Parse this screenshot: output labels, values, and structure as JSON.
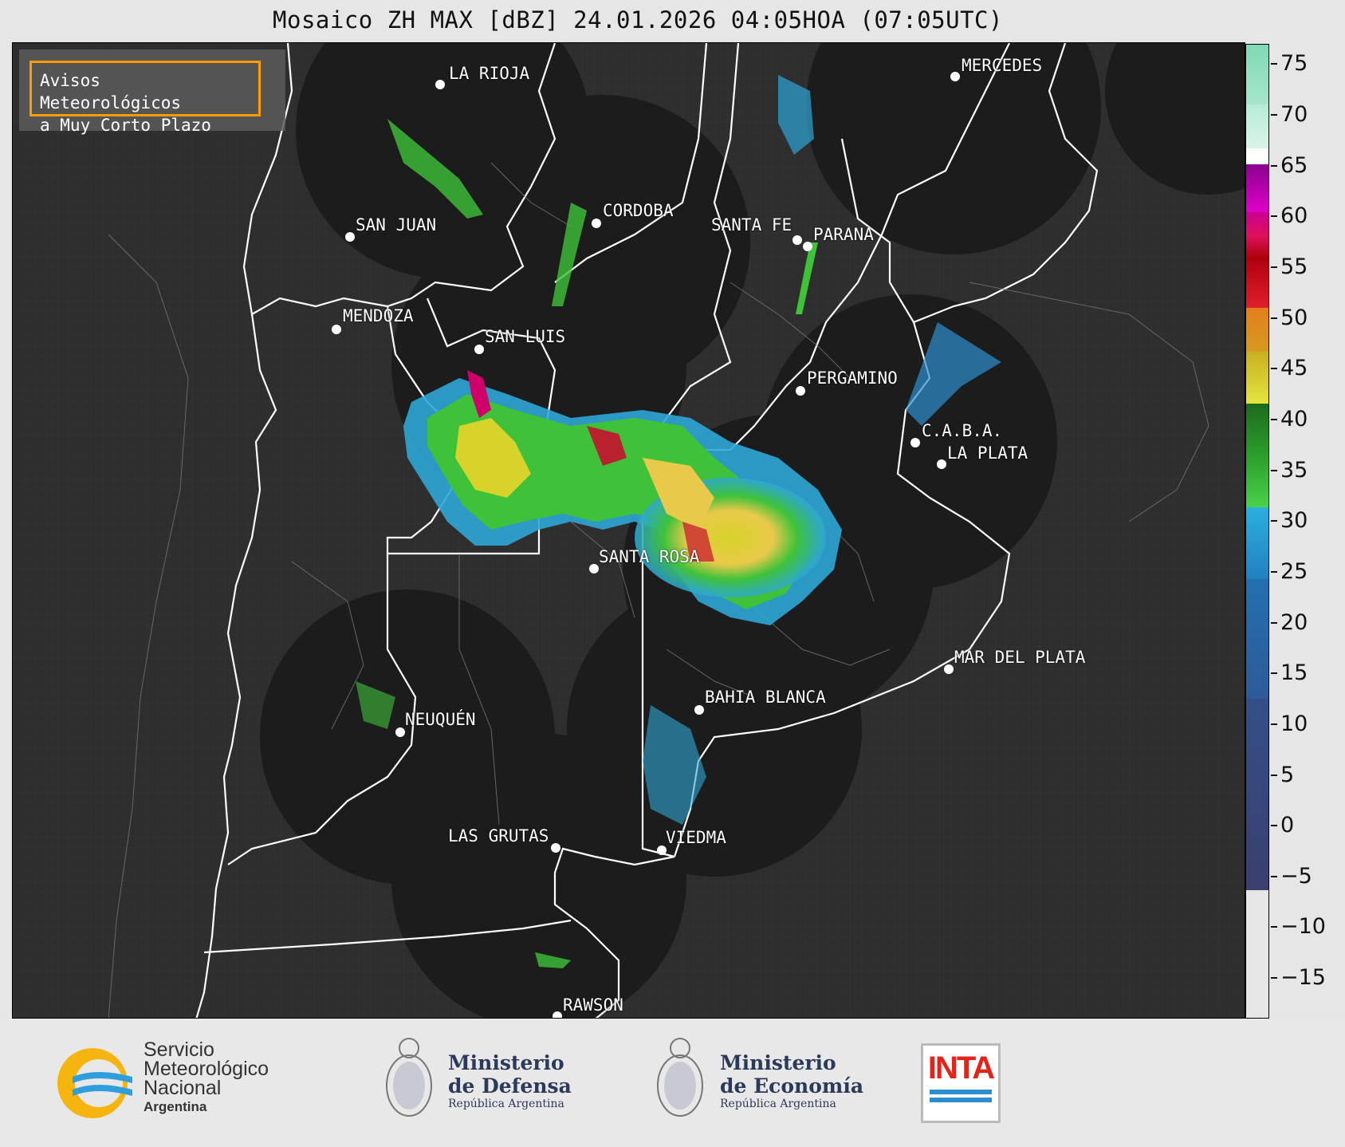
{
  "title": "Mosaico ZH MAX [dBZ] 24.01.2026 04:05HOA (07:05UTC)",
  "avisos": {
    "line1": "Avisos Meteorológicos",
    "line2": "a Muy Corto Plazo"
  },
  "cities": [
    {
      "name": "LA RIOJA"
    },
    {
      "name": "MERCEDES"
    },
    {
      "name": "CORDOBA"
    },
    {
      "name": "SAN JUAN"
    },
    {
      "name": "SANTA FE"
    },
    {
      "name": "PARANA"
    },
    {
      "name": "MENDOZA"
    },
    {
      "name": "SAN LUIS"
    },
    {
      "name": "PERGAMINO"
    },
    {
      "name": "C.A.B.A."
    },
    {
      "name": "LA PLATA"
    },
    {
      "name": "SANTA ROSA"
    },
    {
      "name": "MAR DEL PLATA"
    },
    {
      "name": "BAHIA BLANCA"
    },
    {
      "name": "NEUQUÉN"
    },
    {
      "name": "LAS GRUTAS"
    },
    {
      "name": "VIEDMA"
    },
    {
      "name": "RAWSON"
    }
  ],
  "colorbar": {
    "ticks": [
      "75",
      "70",
      "65",
      "60",
      "55",
      "50",
      "45",
      "40",
      "35",
      "30",
      "25",
      "20",
      "15",
      "10",
      "5",
      "0",
      "−5",
      "−10",
      "−15"
    ],
    "range": [
      -19,
      77
    ]
  },
  "logos": {
    "smn_line1": "Servicio",
    "smn_line2": "Meteorológico",
    "smn_line3": "Nacional",
    "smn_line4": "Argentina",
    "defensa_line1": "Ministerio",
    "defensa_line2": "de Defensa",
    "defensa_line3": "República Argentina",
    "economia_line1": "Ministerio",
    "economia_line2": "de Economía",
    "economia_line3": "República Argentina",
    "inta": "INTA"
  },
  "colors": {
    "map_background": "#2e2e2e",
    "radar_coverage": "#1c1c1c",
    "avisos_border": "#ff9d00"
  }
}
